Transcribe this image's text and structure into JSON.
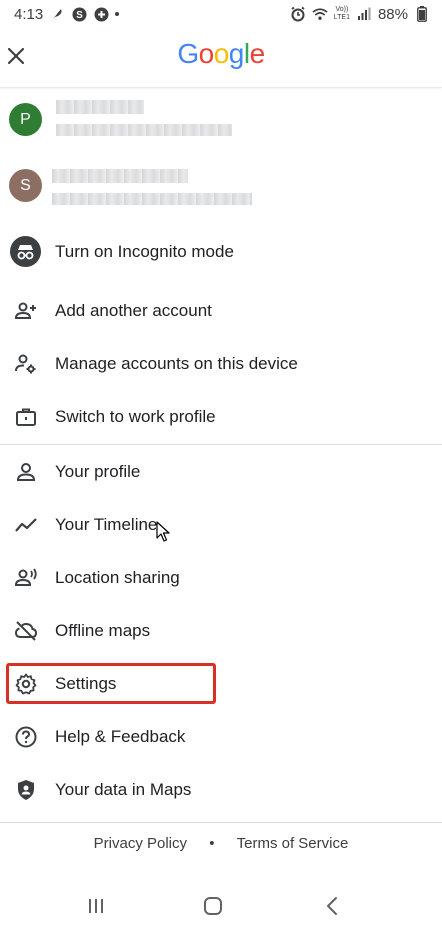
{
  "status_bar": {
    "time": "4:13",
    "battery": "88%",
    "network_label": "LTE1",
    "carrier_label": "Vo))"
  },
  "header": {
    "logo_letters": [
      "G",
      "o",
      "o",
      "g",
      "l",
      "e"
    ],
    "close_icon": "close-icon"
  },
  "accounts": [
    {
      "initial": "P",
      "color": "#2E7D32"
    },
    {
      "initial": "S",
      "color": "#8D6E63"
    }
  ],
  "menu": {
    "incognito": "Turn on Incognito mode",
    "add_account": "Add another account",
    "manage_accounts": "Manage accounts on this device",
    "work_profile": "Switch to work profile",
    "your_profile": "Your profile",
    "your_timeline": "Your Timeline",
    "location_sharing": "Location sharing",
    "offline_maps": "Offline maps",
    "settings": "Settings",
    "help_feedback": "Help & Feedback",
    "your_data": "Your data in Maps"
  },
  "footer": {
    "privacy": "Privacy Policy",
    "separator": "•",
    "terms": "Terms of Service"
  },
  "colors": {
    "highlight": "#d93025",
    "icon": "#3c4043"
  }
}
